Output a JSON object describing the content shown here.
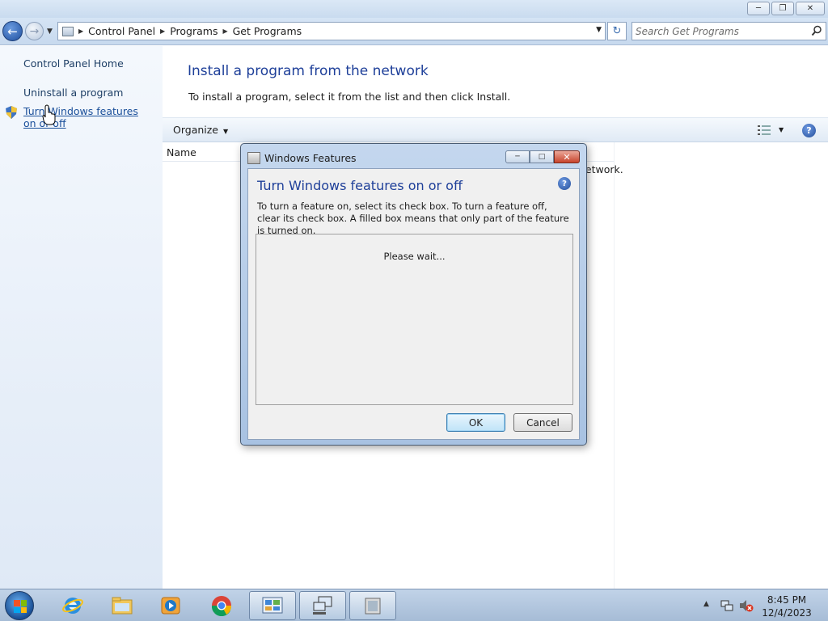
{
  "window": {
    "min_icon": "minimize-icon",
    "max_icon": "maximize-icon",
    "close_icon": "close-icon"
  },
  "address_bar": {
    "breadcrumbs": [
      "Control Panel",
      "Programs",
      "Get Programs"
    ],
    "search_placeholder": "Search Get Programs"
  },
  "left_nav": {
    "home": "Control Panel Home",
    "uninstall": "Uninstall a program",
    "features": "Turn Windows features on or off"
  },
  "main": {
    "title": "Install a program from the network",
    "description": "To install a program, select it from the list and then click Install.",
    "toolbar": {
      "organize": "Organize"
    },
    "columns": [
      "Name"
    ],
    "partial_text": "network."
  },
  "dialog": {
    "title": "Windows Features",
    "heading": "Turn Windows features on or off",
    "description": "To turn a feature on, select its check box. To turn a feature off, clear its check box. A filled box means that only part of the feature is turned on.",
    "status": "Please wait...",
    "ok_label": "OK",
    "cancel_label": "Cancel"
  },
  "taskbar": {
    "items": [
      "internet-explorer",
      "windows-explorer",
      "media-player",
      "chrome",
      "control-panel",
      "network-connections",
      "windows-features"
    ],
    "time": "8:45 PM",
    "date": "12/4/2023"
  },
  "colors": {
    "heading_blue": "#1e3f99",
    "link_blue": "#1a4f9a",
    "close_red": "#c7432b"
  }
}
